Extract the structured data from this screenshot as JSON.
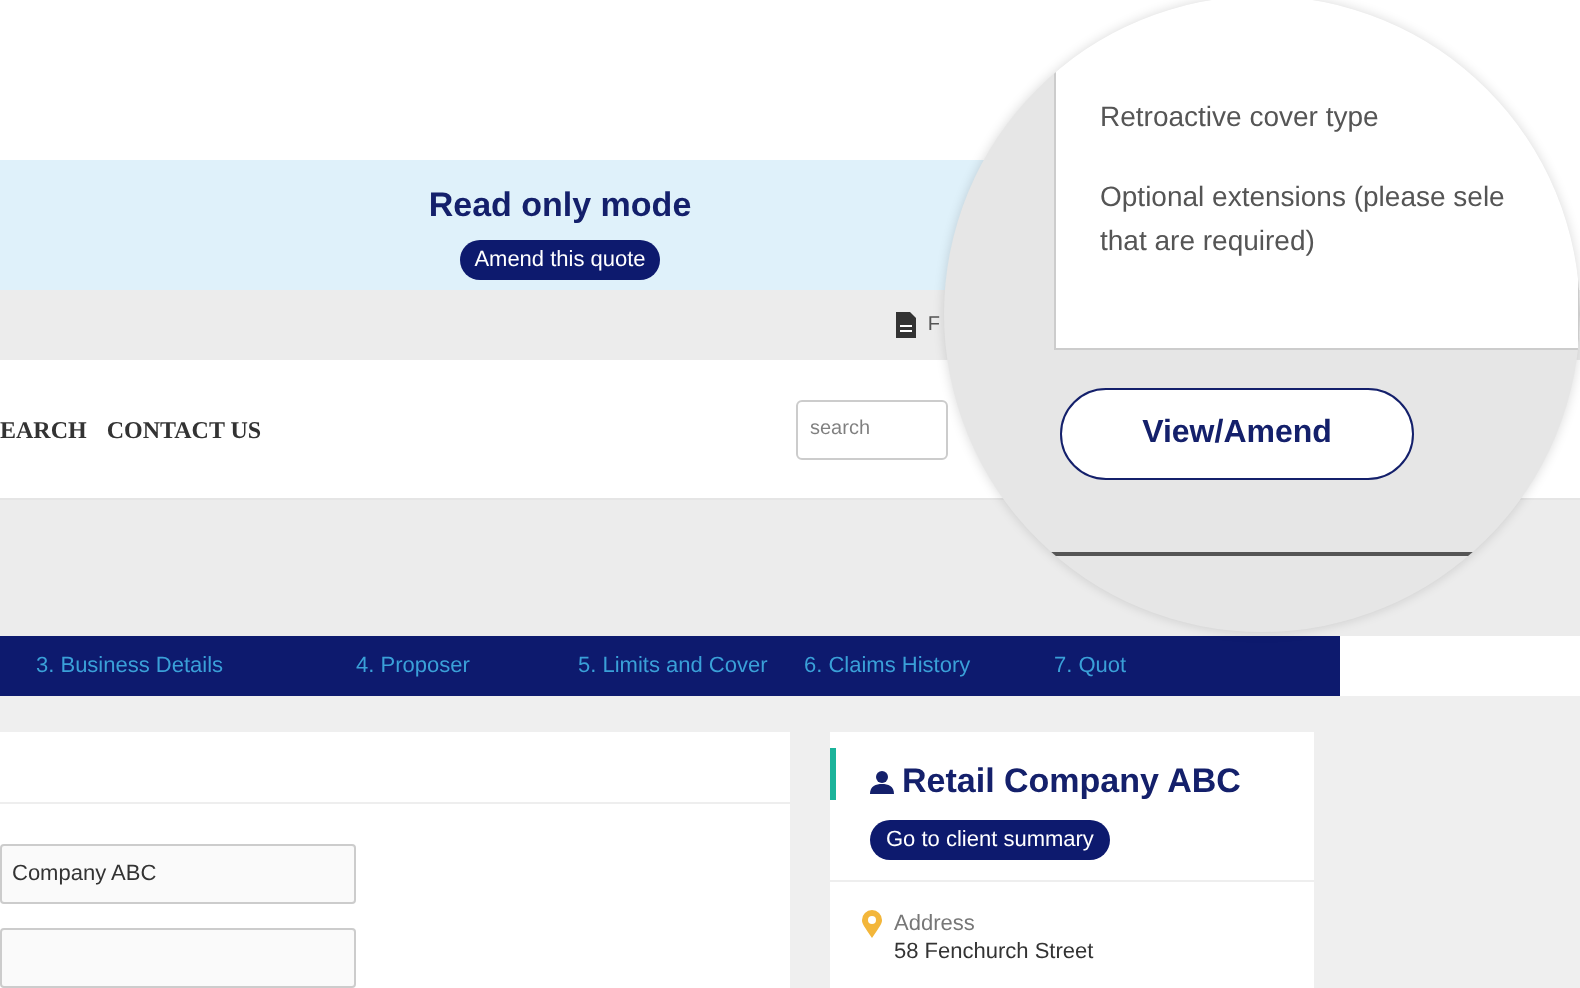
{
  "banner": {
    "title": "Read only mode",
    "button": "Amend this quote"
  },
  "toolbar": {
    "link": "F"
  },
  "nav": {
    "items": [
      "EARCH",
      "CONTACT US"
    ],
    "search": {
      "placeholder": "search"
    }
  },
  "steps": [
    {
      "label": "3. Business Details"
    },
    {
      "label": "4. Proposer"
    },
    {
      "label": "5. Limits and Cover"
    },
    {
      "label": "6. Claims History"
    },
    {
      "label": "7. Quot"
    }
  ],
  "form": {
    "fields": [
      {
        "value": "Company ABC"
      }
    ]
  },
  "client_card": {
    "name": "Retail Company ABC",
    "button": "Go to client summary",
    "address_label": "Address",
    "address": "58 Fenchurch Street"
  },
  "magnifier": {
    "labels": [
      {
        "lines": [
          "Retroactive cover type"
        ]
      },
      {
        "lines": [
          "Optional extensions (please sele",
          "that are required)"
        ]
      }
    ],
    "button": "View/Amend"
  }
}
